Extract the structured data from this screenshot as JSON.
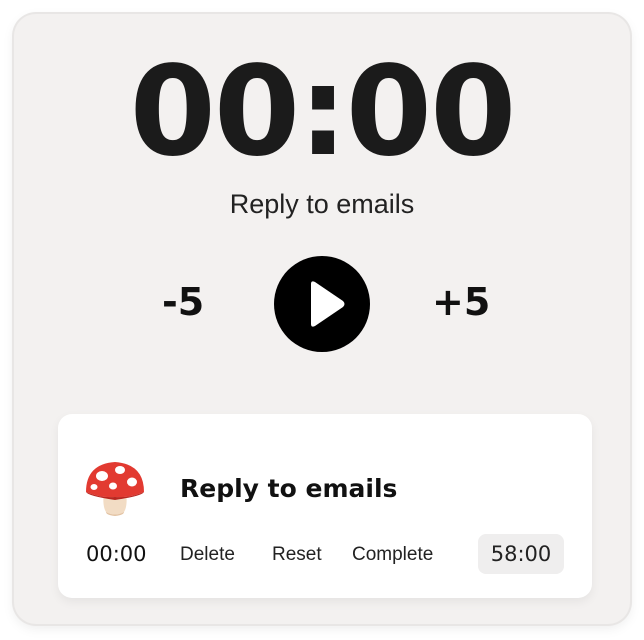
{
  "timer": {
    "display": "00:00",
    "task_title": "Reply to emails"
  },
  "controls": {
    "minus_label": "-5",
    "plus_label": "+5",
    "play_icon": "play-icon"
  },
  "task_card": {
    "emoji": "🍄",
    "emoji_icon": "mushroom-icon",
    "title": "Reply to emails",
    "elapsed": "00:00",
    "actions": {
      "delete": "Delete",
      "reset": "Reset",
      "complete": "Complete"
    },
    "duration": "58:00"
  },
  "colors": {
    "widget_background": "#f3f1f0",
    "card_background": "#ffffff",
    "play_button": "#000000",
    "text_primary": "#111111",
    "mushroom_cap": "#e23a31"
  }
}
